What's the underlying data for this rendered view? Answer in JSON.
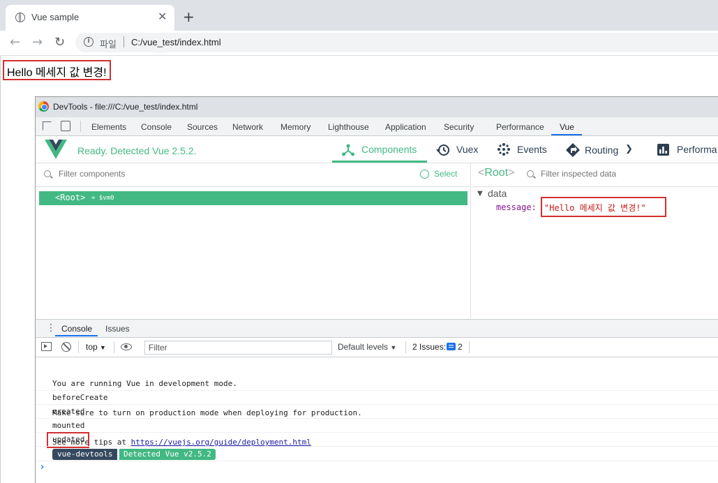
{
  "browser": {
    "tab_title": "Vue sample",
    "tab_close": "✕",
    "new_tab": "+",
    "scheme_label": "파일",
    "url": "C:/vue_test/index.html"
  },
  "page": {
    "hello_text": "Hello 메세지 값 변경!"
  },
  "devtools": {
    "window_title": "DevTools - file:///C:/vue_test/index.html",
    "tabs": [
      "Elements",
      "Console",
      "Sources",
      "Network",
      "Memory",
      "Lighthouse",
      "Application",
      "Security",
      "Performance",
      "Vue"
    ],
    "active_tab": "Vue"
  },
  "vue": {
    "status": "Ready. Detected Vue 2.5.2.",
    "nav": {
      "components": "Components",
      "vuex": "Vuex",
      "events": "Events",
      "routing": "Routing",
      "performance": "Performa"
    },
    "filter_components_placeholder": "Filter components",
    "select_label": "Select",
    "root_label": "<Root>",
    "root_vm": "= $vm0",
    "inspector": {
      "root_open": "<",
      "root_name": "Root",
      "root_close": ">",
      "filter_placeholder": "Filter inspected data",
      "section": "data",
      "key": "message:",
      "value": "\"Hello 메세지 값 변경!\""
    }
  },
  "console": {
    "drawer_tabs": [
      "Console",
      "Issues"
    ],
    "context": "top",
    "filter_placeholder": "Filter",
    "levels": "Default levels",
    "issues_label": "2 Issues:",
    "issues_count": "2",
    "messages": {
      "dev_mode_1": "You are running Vue in development mode.",
      "dev_mode_2": "Make sure to turn on production mode when deploying for production.",
      "dev_mode_3_prefix": "See more tips at ",
      "dev_mode_3_link": "https://vuejs.org/guide/deployment.html",
      "before_create": "beforeCreate",
      "created": "created",
      "mounted": "mounted",
      "updated": "updated"
    },
    "badge_name": "vue-devtools",
    "badge_detected": "Detected Vue v2.5.2",
    "prompt": "›"
  },
  "colors": {
    "vue_green": "#42b983",
    "vue_dark": "#35495e",
    "highlight_red": "#d32f2f",
    "devtools_blue": "#1a73e8"
  }
}
